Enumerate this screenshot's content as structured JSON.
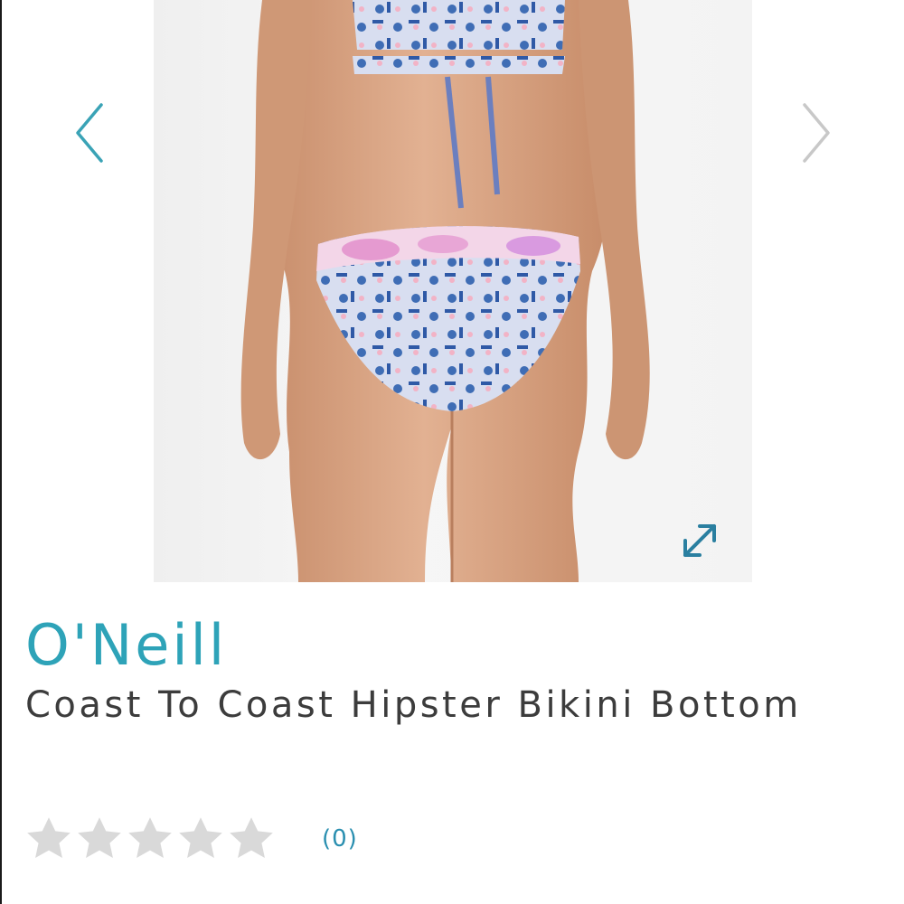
{
  "product": {
    "brand": "O'Neill",
    "title": "Coast To Coast Hipster Bikini Bottom",
    "review_count": "(0)",
    "rating": 0,
    "rating_max": 5
  },
  "gallery": {
    "prev_icon": "chevron-left-icon",
    "next_icon": "chevron-right-icon",
    "expand_icon": "expand-icon"
  },
  "colors": {
    "accent": "#2ea3b8",
    "arrow_prev": "#3aa3b6",
    "arrow_next": "#c8c8c8",
    "star_empty": "#d9d9d9",
    "review_link": "#2a8fb0",
    "title_text": "#3c3c3c"
  }
}
